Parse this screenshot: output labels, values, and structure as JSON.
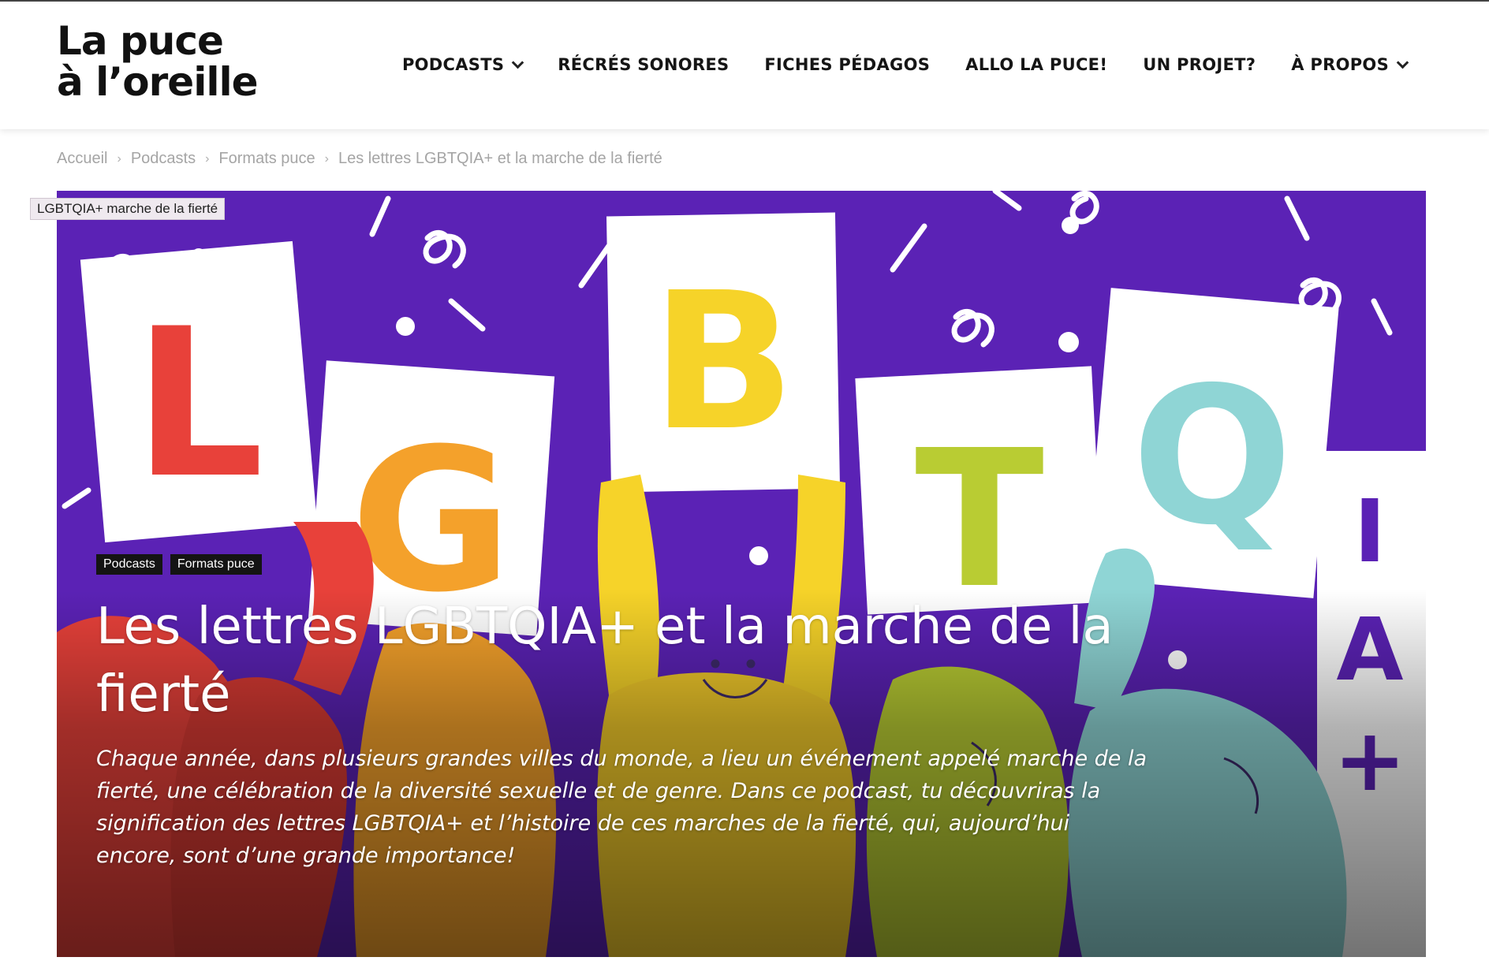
{
  "site": {
    "logo_line1": "La puce",
    "logo_line2": "à l’oreille"
  },
  "nav": {
    "items": [
      {
        "label": "PODCASTS",
        "dropdown": true
      },
      {
        "label": "RÉCRÉS SONORES",
        "dropdown": false
      },
      {
        "label": "FICHES PÉDAGOS",
        "dropdown": false
      },
      {
        "label": "ALLO LA PUCE!",
        "dropdown": false
      },
      {
        "label": "UN PROJET?",
        "dropdown": false
      },
      {
        "label": "À PROPOS",
        "dropdown": true
      }
    ]
  },
  "breadcrumb": {
    "items": [
      "Accueil",
      "Podcasts",
      "Formats puce",
      "Les lettres LGBTQIA+ et la marche de la fierté"
    ],
    "separator": "›"
  },
  "hero": {
    "image_tooltip": "LGBTQIA+ marche de la fierté",
    "categories": [
      "Podcasts",
      "Formats puce"
    ],
    "title": "Les lettres LGBTQIA+ et la marche de la fierté",
    "description": "Chaque année, dans plusieurs grandes villes du monde, a lieu un événement appelé marche de la fierté, une célébration de la diversité sexuelle et de genre. Dans ce podcast, tu découvriras la signification des lettres LGBTQIA+ et l’histoire de ces marches de la fierté, qui, aujourd’hui encore, sont d’une grande importance!",
    "illustration_letters": [
      "L",
      "G",
      "B",
      "T",
      "Q",
      "I",
      "A",
      "+"
    ],
    "colors": {
      "background": "#5b22b5",
      "L": "#e8413a",
      "G": "#f4a12b",
      "B": "#f6d329",
      "T": "#b9cc33",
      "Q": "#8fd5d5",
      "IA": "#5b22b5"
    }
  }
}
